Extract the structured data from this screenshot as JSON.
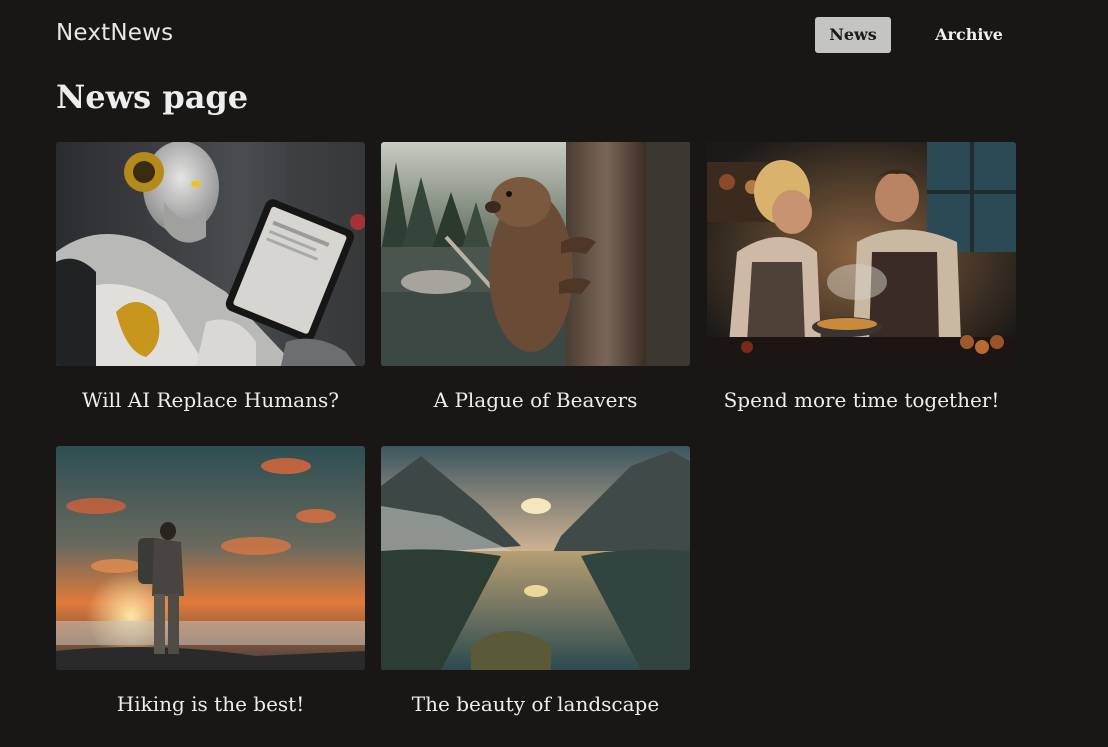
{
  "header": {
    "brand": "NextNews",
    "nav": {
      "news_label": "News",
      "archive_label": "Archive"
    }
  },
  "main": {
    "title": "News page",
    "articles": [
      {
        "title": "Will AI Replace Humans?",
        "image": "robot-with-tablet-image"
      },
      {
        "title": "A Plague of Beavers",
        "image": "beaver-on-tree-image"
      },
      {
        "title": "Spend more time together!",
        "image": "couple-cooking-image"
      },
      {
        "title": "Hiking is the best!",
        "image": "hiker-at-sunset-image"
      },
      {
        "title": "The beauty of landscape",
        "image": "mountain-lake-image"
      }
    ]
  },
  "colors": {
    "background": "#181716",
    "active_nav_bg": "#c4c4c1",
    "text": "#ececec"
  }
}
